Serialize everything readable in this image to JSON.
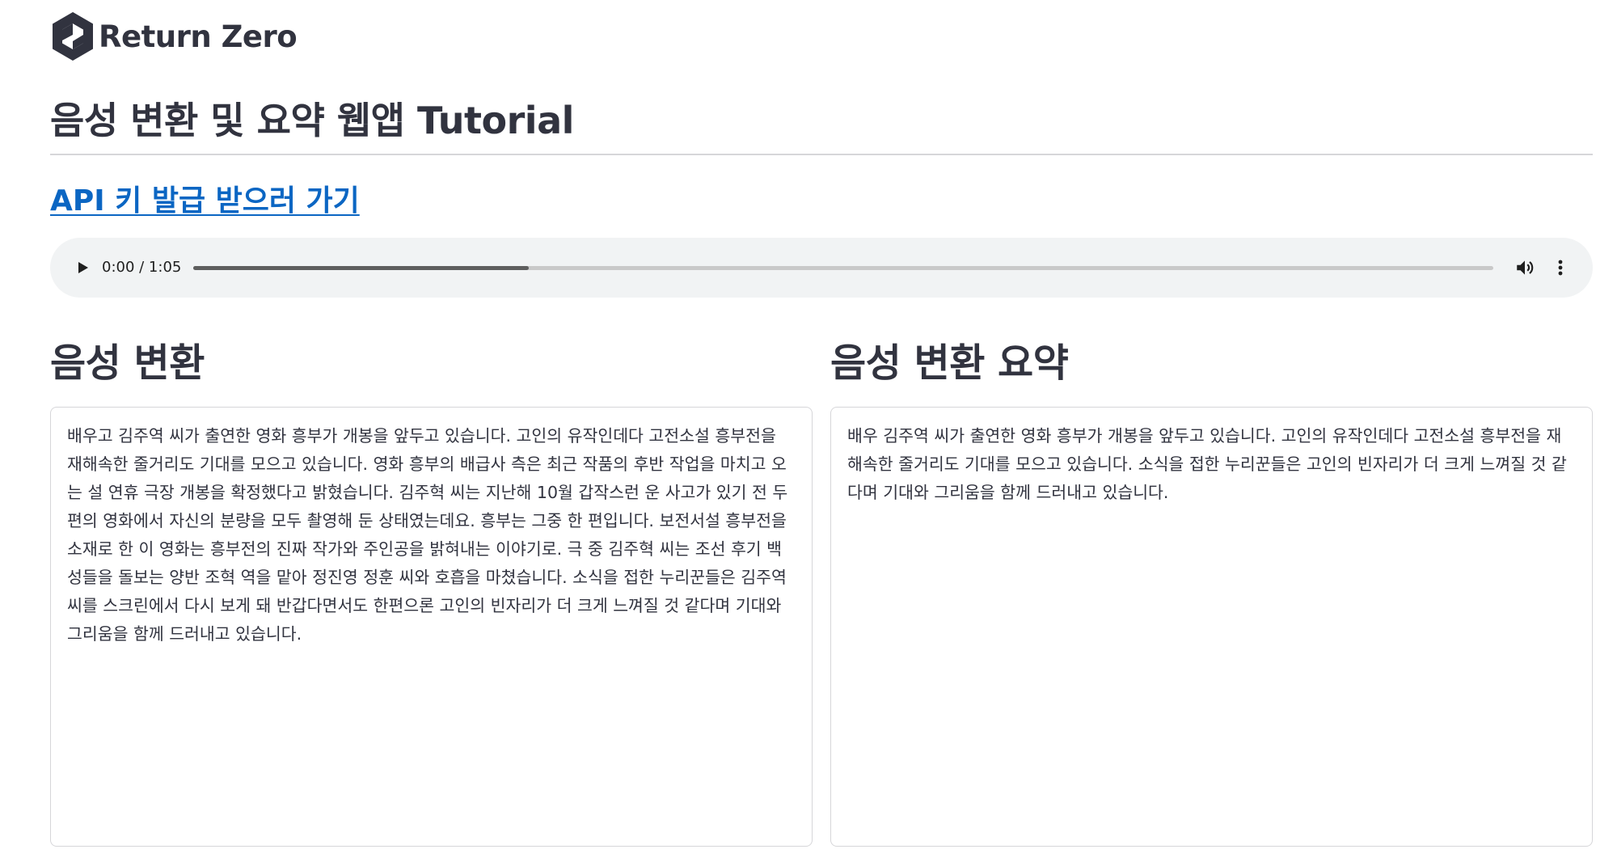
{
  "brand": {
    "name": "Return Zero",
    "logo_icon": "hexagon-logo-icon"
  },
  "page": {
    "title": "음성 변환 및 요약 웹앱 Tutorial"
  },
  "api_link": {
    "label": "API 키 발급 받으러 가기"
  },
  "audio_player": {
    "time": "0:00 / 1:05",
    "buffered_fraction": 0.258,
    "play_icon": "play-icon",
    "volume_icon": "volume-icon",
    "more_icon": "more-vertical-icon"
  },
  "transcription": {
    "heading": "음성 변환",
    "text": "배우고 김주역 씨가 출연한 영화 흥부가 개봉을 앞두고 있습니다. 고인의 유작인데다 고전소설 흥부전을 재해속한 줄거리도 기대를 모으고 있습니다. 영화 흥부의 배급사 측은 최근 작품의 후반 작업을 마치고 오는 설 연휴 극장 개봉을 확정했다고 밝혔습니다. 김주혁 씨는 지난해 10월 갑작스런 운 사고가 있기 전 두 편의 영화에서 자신의 분량을 모두 촬영해 둔 상태였는데요. 흥부는 그중 한 편입니다. 보전서설 흥부전을 소재로 한 이 영화는 흥부전의 진짜 작가와 주인공을 밝혀내는 이야기로. 극 중 김주혁 씨는 조선 후기 백성들을 돌보는 양반 조혁 역을 맡아 정진영 정훈 씨와 호흡을 마쳤습니다. 소식을 접한 누리꾼들은 김주역 씨를 스크린에서 다시 보게 돼 반갑다면서도 한편으론 고인의 빈자리가 더 크게 느껴질 것 같다며 기대와 그리움을 함께 드러내고 있습니다."
  },
  "summary": {
    "heading": "음성 변환 요약",
    "text": "배우 김주역 씨가 출연한 영화 흥부가 개봉을 앞두고 있습니다. 고인의 유작인데다 고전소설 흥부전을 재해속한 줄거리도 기대를 모으고 있습니다. 소식을 접한 누리꾼들은 고인의 빈자리가 더 크게 느껴질 것 같다며 기대와 그리움을 함께 드러내고 있습니다."
  },
  "colors": {
    "text": "#31333f",
    "link": "#0b66c3",
    "player_bg": "#f1f3f4",
    "border": "#d6d6d9"
  }
}
